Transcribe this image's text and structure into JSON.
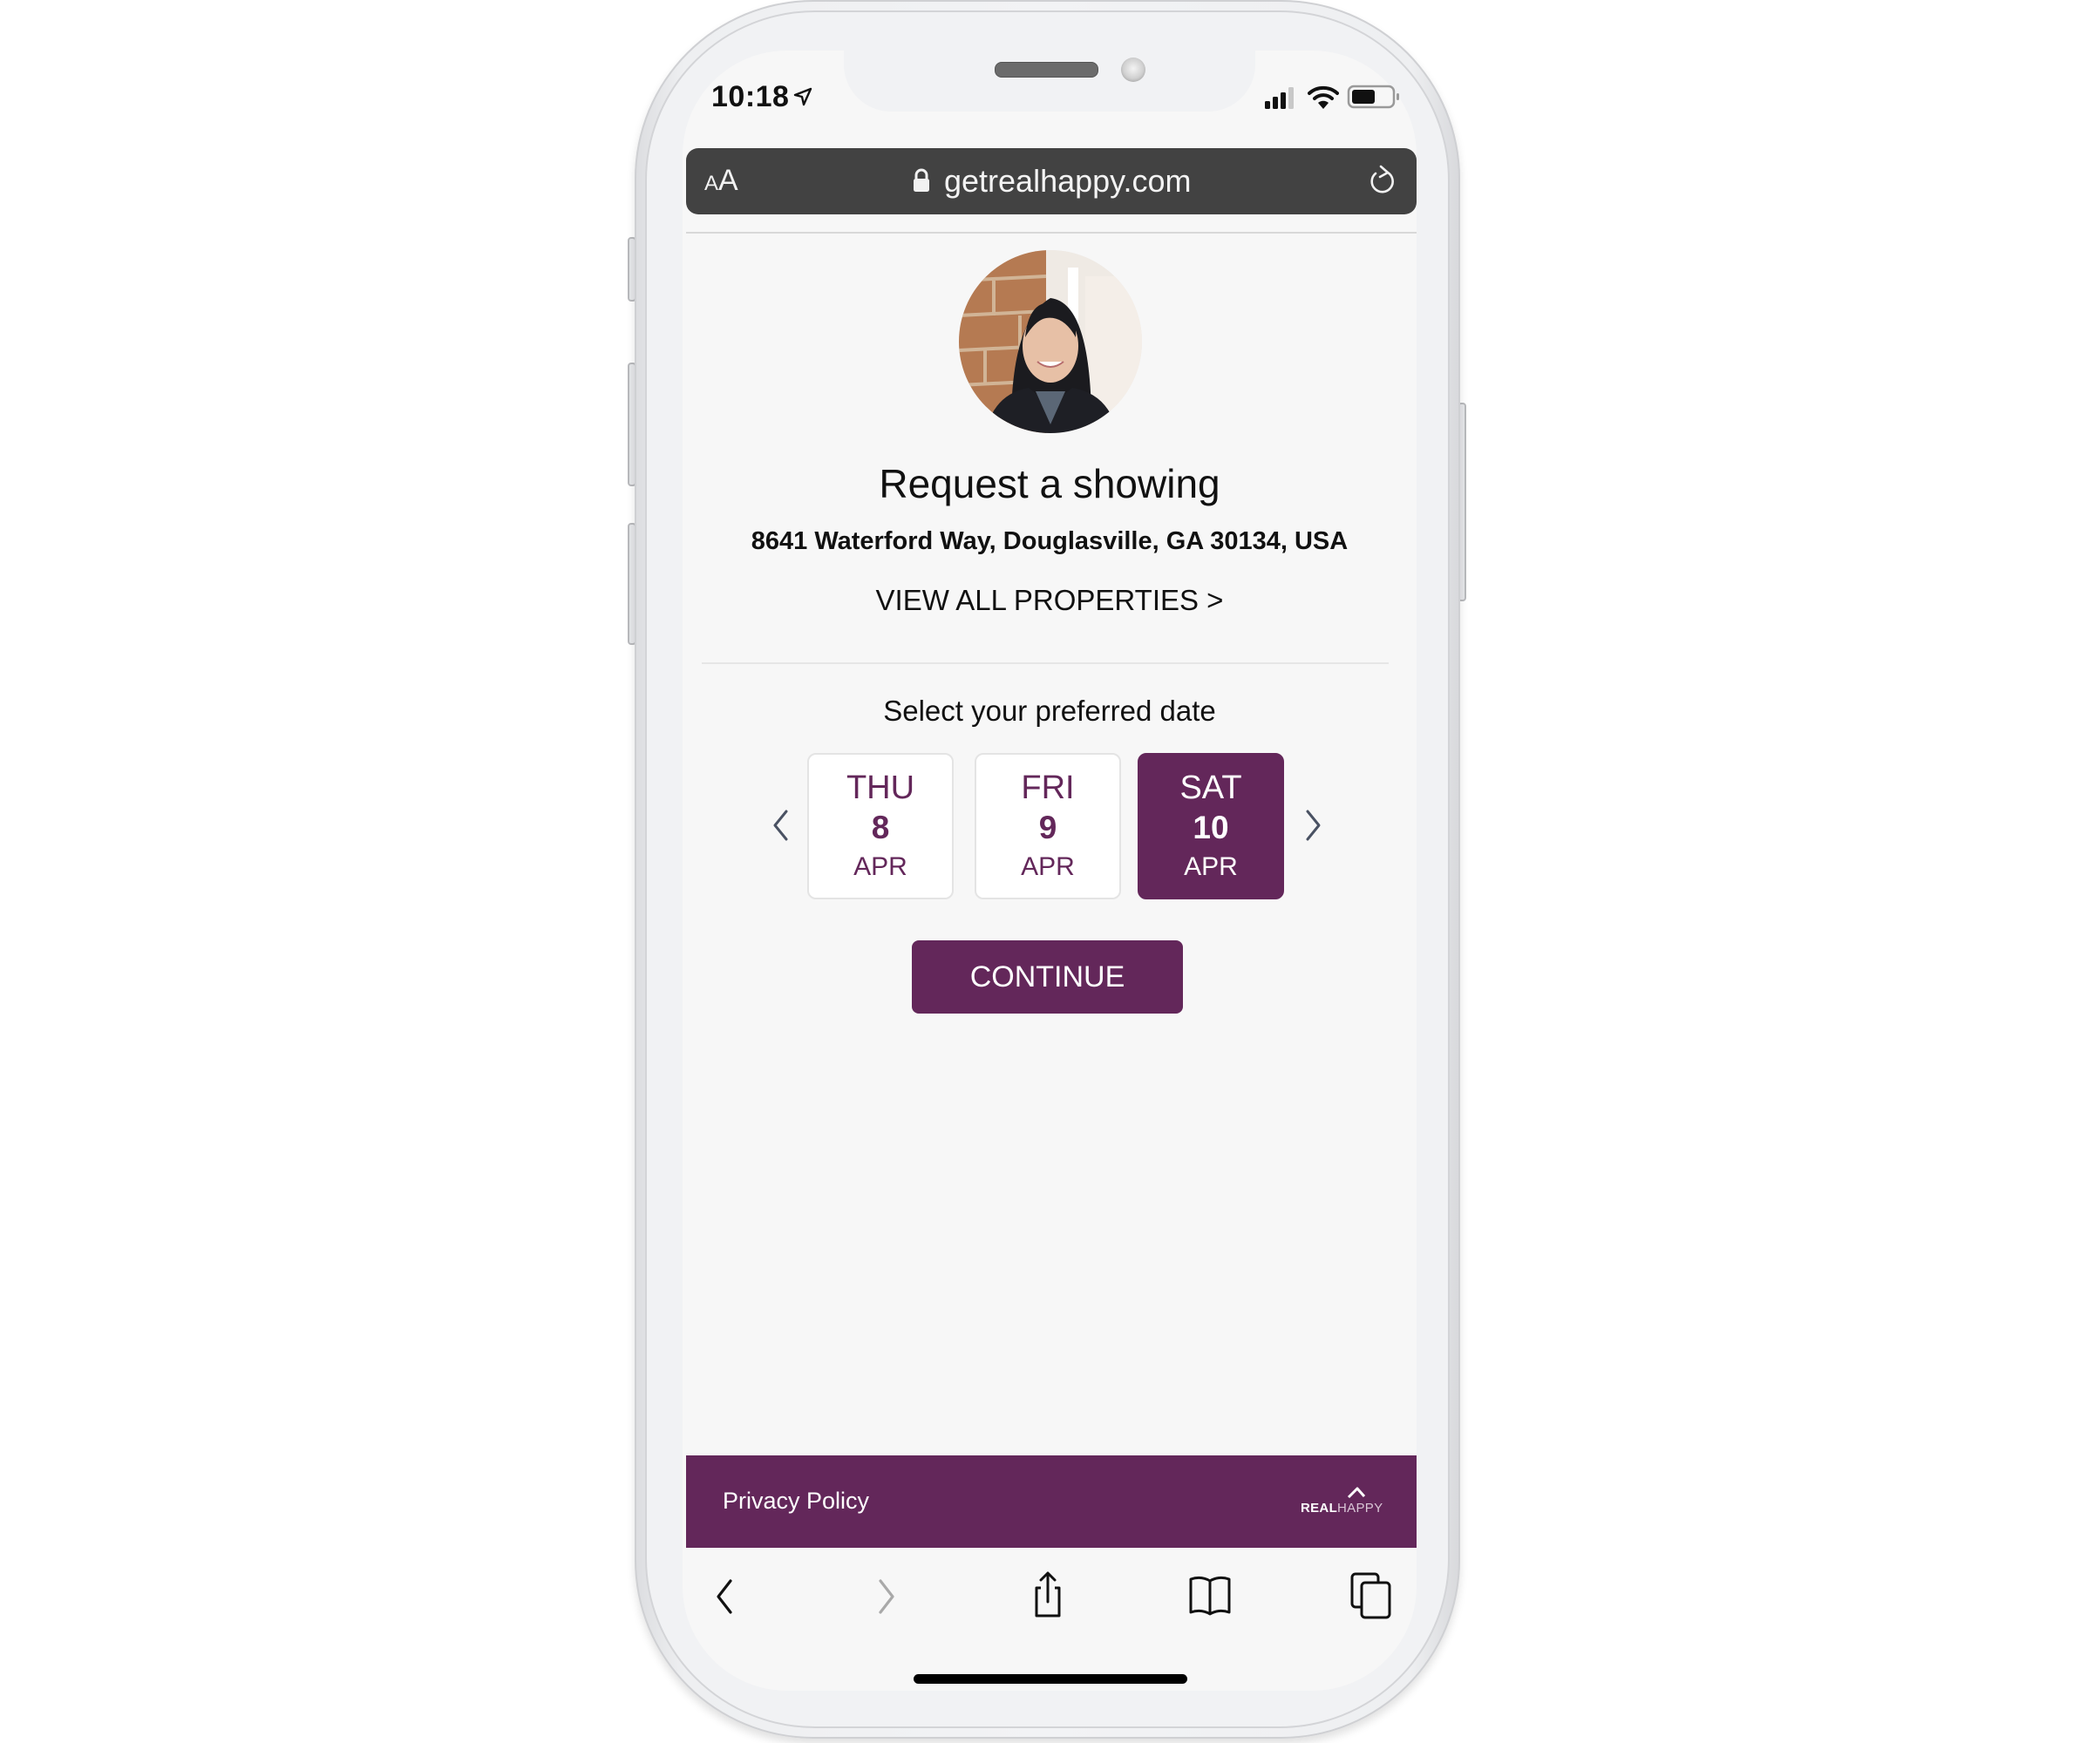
{
  "status_bar": {
    "time": "10:18",
    "location_icon": "location-arrow-icon",
    "signal_bars": 3,
    "signal_bars_total": 4,
    "wifi_icon": "wifi-icon",
    "battery_level": 0.6
  },
  "browser": {
    "text_size_label_small": "A",
    "text_size_label_large": "A",
    "url": "getrealhappy.com",
    "lock_icon": "lock-icon",
    "reload_icon": "reload-icon"
  },
  "page": {
    "heading": "Request a showing",
    "address": "8641 Waterford Way, Douglasville, GA 30134, USA",
    "view_all_link": "VIEW ALL PROPERTIES >",
    "date_prompt": "Select your preferred date",
    "dates": [
      {
        "dow": "THU",
        "day": "8",
        "month": "APR",
        "selected": false
      },
      {
        "dow": "FRI",
        "day": "9",
        "month": "APR",
        "selected": false
      },
      {
        "dow": "SAT",
        "day": "10",
        "month": "APR",
        "selected": true
      }
    ],
    "continue_label": "CONTINUE",
    "accent_color": "#63275A"
  },
  "footer": {
    "privacy_link": "Privacy Policy",
    "logo_real": "REAL",
    "logo_happy": "HAPPY"
  },
  "toolbar": {
    "items": [
      "back-icon",
      "forward-icon",
      "share-icon",
      "bookmarks-icon",
      "tabs-icon"
    ]
  }
}
